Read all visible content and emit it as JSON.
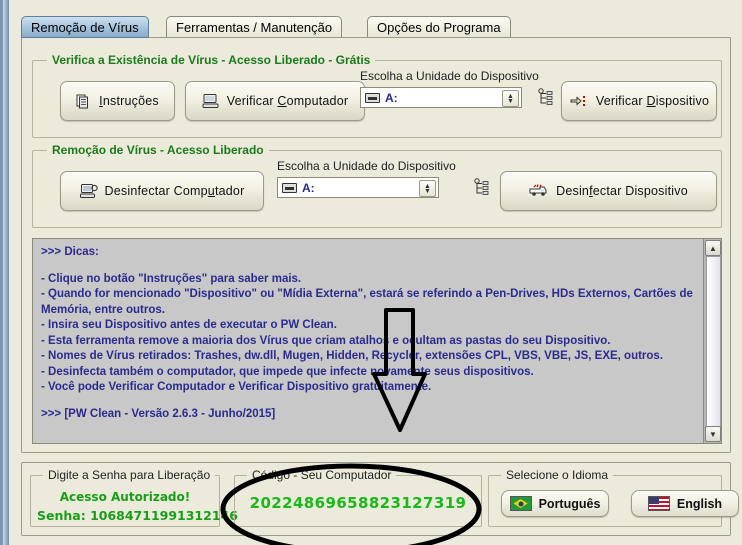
{
  "window": {
    "tabs": [
      {
        "label": "Remoção de Vírus",
        "active": true
      },
      {
        "label": "Ferramentas / Manutenção",
        "active": false
      },
      {
        "label": "Opções do Programa",
        "active": false
      }
    ]
  },
  "scan_group": {
    "legend": "Verifica a Existência de Vírus  - Acesso Liberado - Grátis",
    "instructions_button": "Instruções",
    "check_computer_button": "Verificar Computador",
    "check_device_button": "Verificar Dispositivo",
    "drive_label": "Escolha a Unidade do Dispositivo",
    "drive_value": "A:"
  },
  "remove_group": {
    "legend": "Remoção de Vírus - Acesso Liberado",
    "disinfect_computer_button": "Desinfectar Computador",
    "disinfect_device_button": "Desinfectar Dispositivo",
    "drive_label": "Escolha a Unidade do Dispositivo",
    "drive_value": "A:"
  },
  "memo": {
    "lines": [
      ">>> Dicas:",
      "",
      "- Clique no botão \"Instruções\" para saber mais.",
      "- Quando for mencionado \"Dispositivo\" ou \"Mídia Externa\", estará se referindo a Pen-Drives, HDs Externos, Cartões de Memória, entre outros.",
      "- Insira seu Dispositivo antes de executar o PW Clean.",
      "- Esta ferramenta remove a maioria dos Vírus que criam atalhos e ocultam as pastas do seu Dispositivo.",
      "- Nomes de Vírus retirados: Trashes, dw.dll, Mugen, Hidden, Recycler, extensões CPL, VBS, VBE, JS, EXE, outros.",
      "- Desinfecta também o computador, que impede que infecte novamente seus dispositivos.",
      "- Você pode Verificar Computador e Verificar Dispositivo gratuitamente.",
      "",
      ">>> [PW Clean - Versão 2.6.3 - Junho/2015]"
    ]
  },
  "password_group": {
    "legend": "Digite a Senha para Liberação",
    "status": "Acesso  Autorizado!",
    "password_line": "Senha: 10684711991312146"
  },
  "code_group": {
    "legend": "Código - Seu Computador",
    "value": "20224869658823127319"
  },
  "language_group": {
    "legend": "Selecione o Idioma",
    "portuguese_button": "Português",
    "english_button": "English"
  },
  "colors": {
    "legend_green": "#1b7a1b",
    "memo_text": "#2b2b8f",
    "code_green": "#1bb81b",
    "tab_active": "#a9c6de",
    "panel_bg": "#eceadb",
    "memo_bg": "#c8c8c8"
  }
}
